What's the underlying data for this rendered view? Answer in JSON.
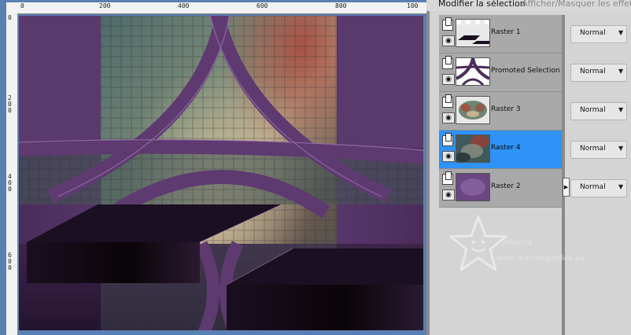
{
  "ruler": {
    "top_labels": [
      "0",
      "200",
      "400",
      "600",
      "800",
      "100"
    ],
    "left_labels": [
      "0",
      "2",
      "0",
      "0",
      "4",
      "0",
      "0",
      "6",
      "0",
      "0"
    ]
  },
  "panel": {
    "modify_selection": "Modifier la sélection",
    "toggle_effects": "Afficher/Masquer les effets d"
  },
  "layers": [
    {
      "name": "Raster 1",
      "blend": "Normal",
      "selected": false
    },
    {
      "name": "Promoted Selection",
      "blend": "Normal",
      "selected": false
    },
    {
      "name": "Raster 3",
      "blend": "Normal",
      "selected": false
    },
    {
      "name": "Raster 4",
      "blend": "Normal",
      "selected": true
    },
    {
      "name": "Raster 2",
      "blend": "Normal",
      "selected": false
    }
  ],
  "watermark": {
    "author": "pinuccia",
    "site": "www.maidiregrafica.eu"
  },
  "colors": {
    "workspace_bg": "#5a7fb3",
    "selected_row": "#2e92f6",
    "purple": "#5e3a70"
  }
}
